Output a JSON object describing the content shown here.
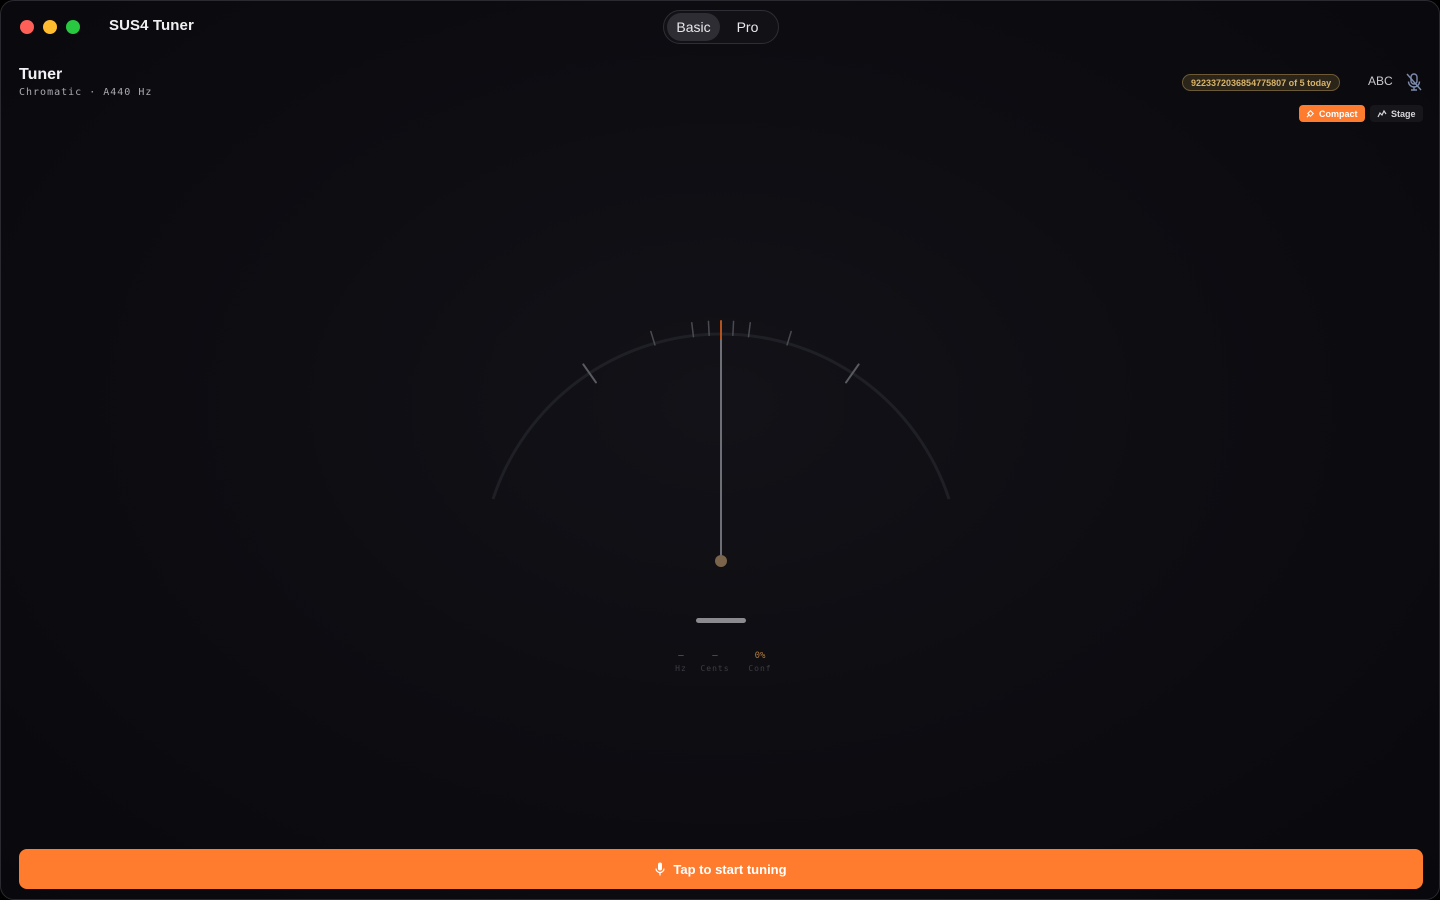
{
  "window": {
    "title": "SUS4 Tuner",
    "traffic_lights": [
      "close-button",
      "minimize-button",
      "zoom-button"
    ]
  },
  "mode_switch": {
    "options": [
      "Basic",
      "Pro"
    ],
    "selected": "Basic"
  },
  "header": {
    "title": "Tuner",
    "subtitle": "Chromatic · A440 Hz",
    "usage_badge": "9223372036854775807 of 5 today",
    "notation_label": "ABC",
    "mic_icon": "mic-off-icon"
  },
  "view_modes": {
    "compact_label": "Compact",
    "stage_label": "Stage",
    "selected": "Compact"
  },
  "meter": {
    "needle_cents": 0,
    "needle_active": false
  },
  "readouts": {
    "hz": {
      "value": "—",
      "label": "Hz"
    },
    "cents": {
      "value": "—",
      "label": "Cents"
    },
    "confidence": {
      "value": "0%",
      "label": "Conf"
    }
  },
  "start_button": {
    "label": "Tap to start tuning",
    "icon": "microphone-icon"
  },
  "colors": {
    "accent": "#ff7b2e",
    "badge_text": "#d8b36a",
    "background": "#0d0d12"
  }
}
